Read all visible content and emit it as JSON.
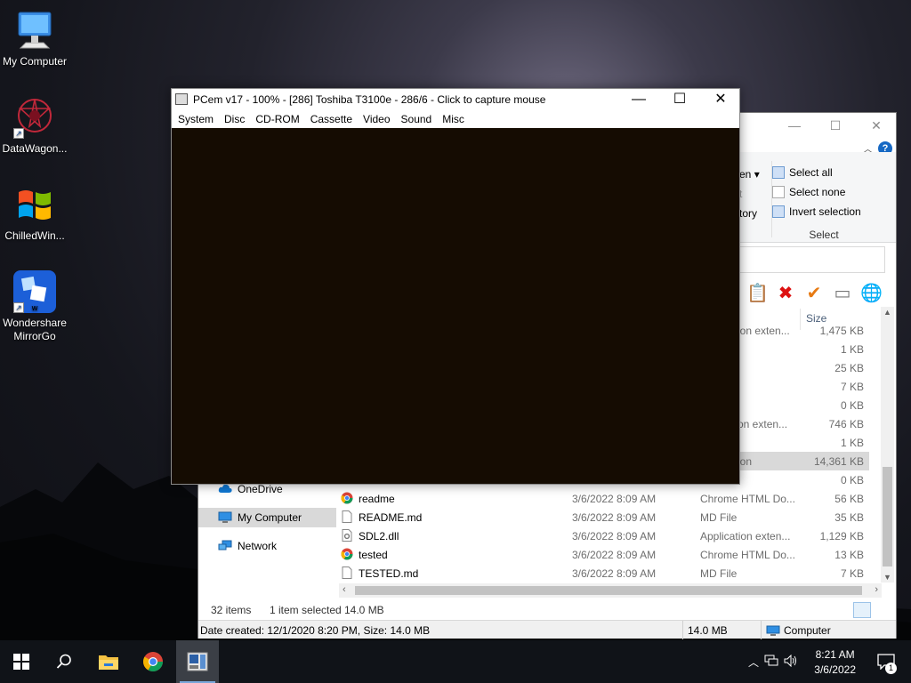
{
  "desktop": {
    "icons": [
      {
        "label": "My Computer"
      },
      {
        "label": "DataWagon..."
      },
      {
        "label": "ChilledWin..."
      },
      {
        "label": "Wondershare MirrorGo"
      }
    ]
  },
  "pcem": {
    "title": "PCem v17 - 100% - [286] Toshiba T3100e - 286/6 - Click to capture mouse",
    "menu": [
      "System",
      "Disc",
      "CD-ROM",
      "Cassette",
      "Video",
      "Sound",
      "Misc"
    ],
    "screen_color": "#150c02"
  },
  "explorer": {
    "ribbon": {
      "partial_open": "en",
      "partial_t": "t",
      "partial_history": "tory",
      "select_all": "Select all",
      "select_none": "Select none",
      "invert_selection": "Invert selection",
      "select_group": "Select"
    },
    "columns": {
      "size": "Size"
    },
    "nav": [
      {
        "label": "OneDrive"
      },
      {
        "label": "My Computer"
      },
      {
        "label": "Network"
      }
    ],
    "files_partial": [
      {
        "type": "ion exten...",
        "size": "1,475 KB"
      },
      {
        "type": "",
        "size": "1 KB"
      },
      {
        "type": "",
        "size": "25 KB"
      },
      {
        "type": "",
        "size": "7 KB"
      },
      {
        "type": "",
        "size": "0 KB"
      },
      {
        "type": "on exten...",
        "size": "746 KB"
      },
      {
        "type": "",
        "size": "1 KB"
      },
      {
        "type": "ion",
        "size": "14,361 KB"
      },
      {
        "type": "",
        "size": "0 KB"
      }
    ],
    "files": [
      {
        "name": "readme",
        "date": "3/6/2022 8:09 AM",
        "type": "Chrome HTML Do...",
        "size": "56 KB"
      },
      {
        "name": "README.md",
        "date": "3/6/2022 8:09 AM",
        "type": "MD File",
        "size": "35 KB"
      },
      {
        "name": "SDL2.dll",
        "date": "3/6/2022 8:09 AM",
        "type": "Application exten...",
        "size": "1,129 KB"
      },
      {
        "name": "tested",
        "date": "3/6/2022 8:09 AM",
        "type": "Chrome HTML Do...",
        "size": "13 KB"
      },
      {
        "name": "TESTED.md",
        "date": "3/6/2022 8:09 AM",
        "type": "MD File",
        "size": "7 KB"
      }
    ],
    "status": {
      "items": "32 items",
      "selected": "1 item selected",
      "size": "14.0 MB"
    },
    "details": {
      "info": "Date created: 12/1/2020 8:20 PM, Size: 14.0 MB",
      "size": "14.0 MB",
      "location": "Computer"
    }
  },
  "taskbar": {
    "time": "8:21 AM",
    "date": "3/6/2022",
    "notifications": "1"
  }
}
